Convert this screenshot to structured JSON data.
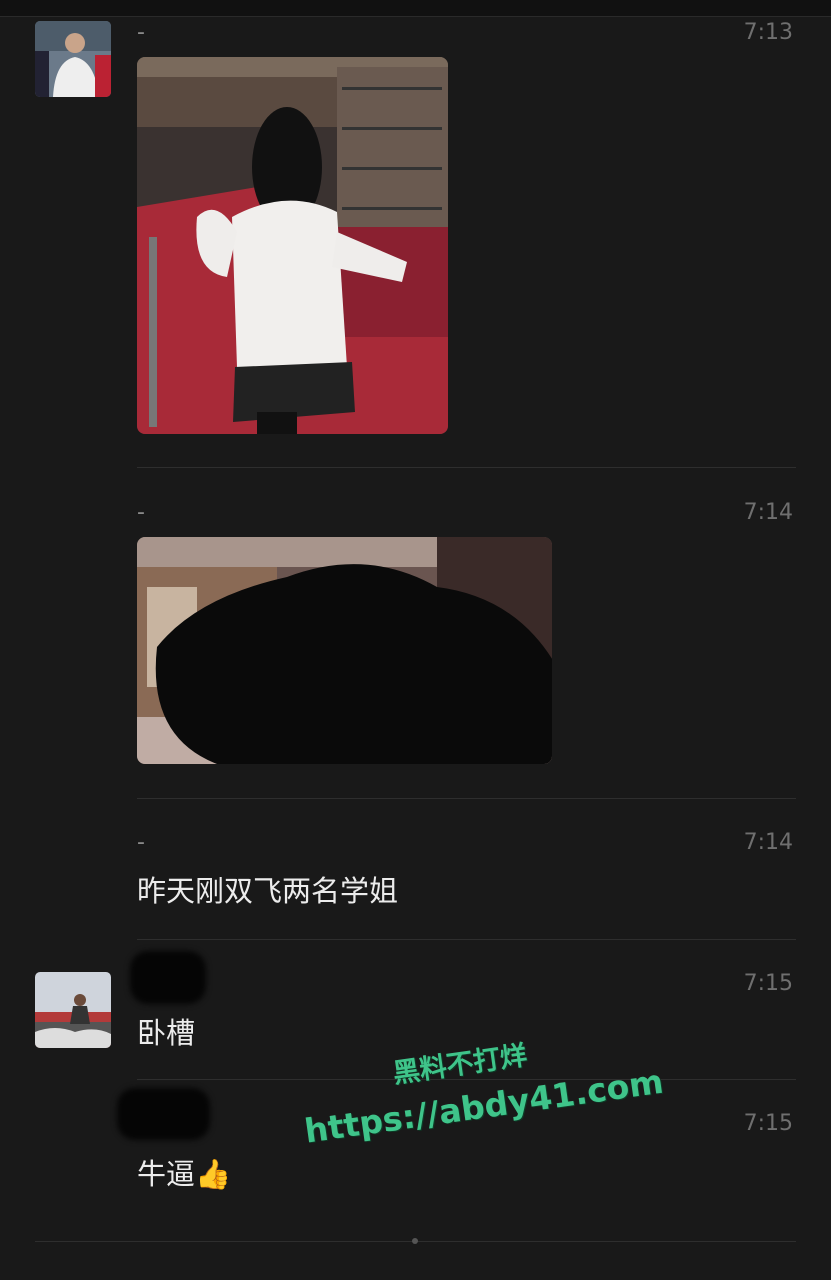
{
  "messages": [
    {
      "name": "-",
      "time": "7:13",
      "type": "image"
    },
    {
      "name": "-",
      "time": "7:14",
      "type": "image"
    },
    {
      "name": "-",
      "time": "7:14",
      "text": "昨天刚双飞两名学姐"
    },
    {
      "name": "",
      "time": "7:15",
      "text": "卧槽"
    },
    {
      "name": "",
      "time": "7:15",
      "text": "牛逼👍"
    }
  ],
  "watermark": {
    "line1": "黑料不打烊",
    "line2": "https://abdy41.com"
  },
  "colors": {
    "background": "#191919",
    "text": "#ececec",
    "muted": "#6f6f6f",
    "watermark": "#3fc48a"
  }
}
